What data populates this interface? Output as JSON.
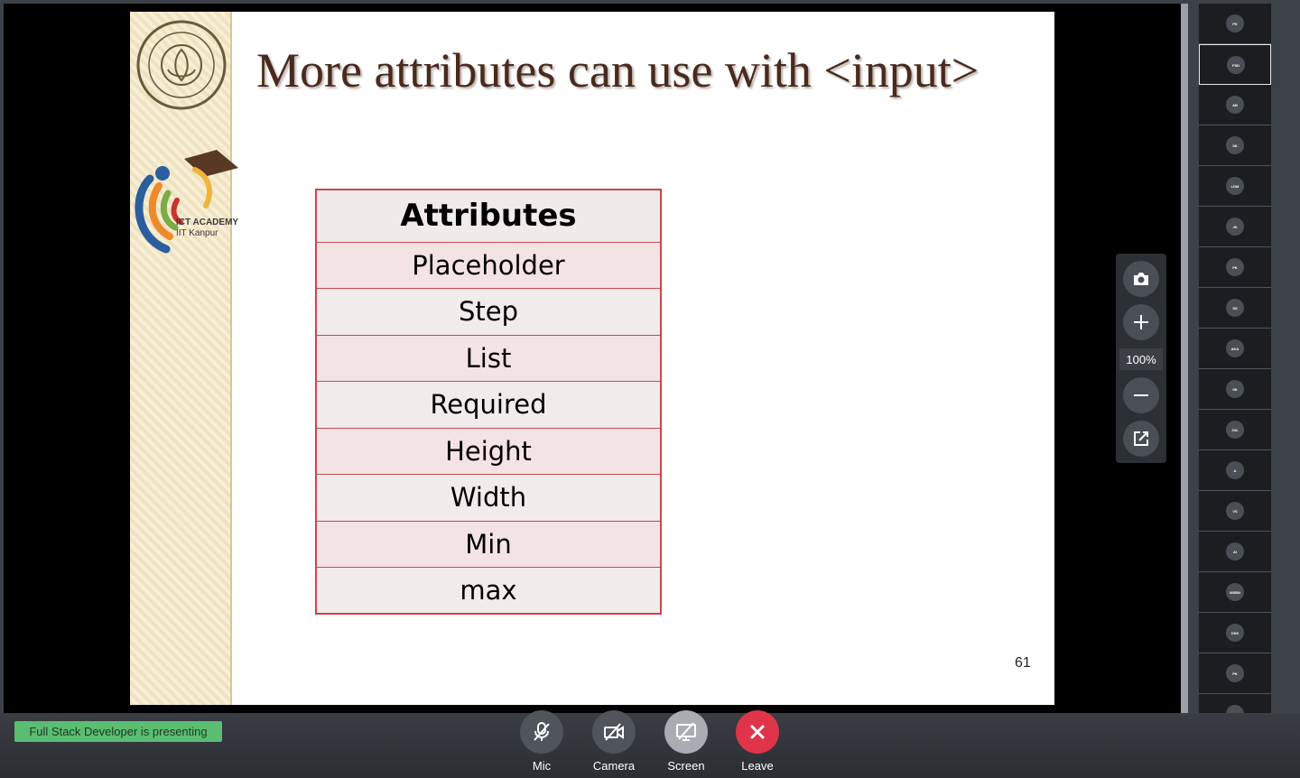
{
  "slide": {
    "title": "More attributes can use with <input>",
    "logo_text": "ICT ACADEMY",
    "logo_subtext": "IIT Kanpur",
    "table_header": "Attributes",
    "table_rows": [
      "Placeholder",
      "Step",
      "List",
      "Required",
      "Height",
      "Width",
      "Min",
      "max"
    ],
    "page_number": "61"
  },
  "zoom": {
    "level": "100%"
  },
  "participants": [
    "PK",
    "FSD",
    "AB",
    "SK",
    "LDM",
    "JK",
    "PK",
    "SS",
    "AKA",
    "SK",
    "JUL",
    "A",
    "VS",
    "AI",
    "MSBN",
    "DSS",
    "PK"
  ],
  "status": {
    "presenting": "Full Stack Developer is presenting"
  },
  "controls": {
    "mic": "Mic",
    "camera": "Camera",
    "screen": "Screen",
    "leave": "Leave"
  },
  "colors": {
    "leave": "#e0344a",
    "screen_active": "#a9acb2",
    "badge": "#5bbd72"
  }
}
